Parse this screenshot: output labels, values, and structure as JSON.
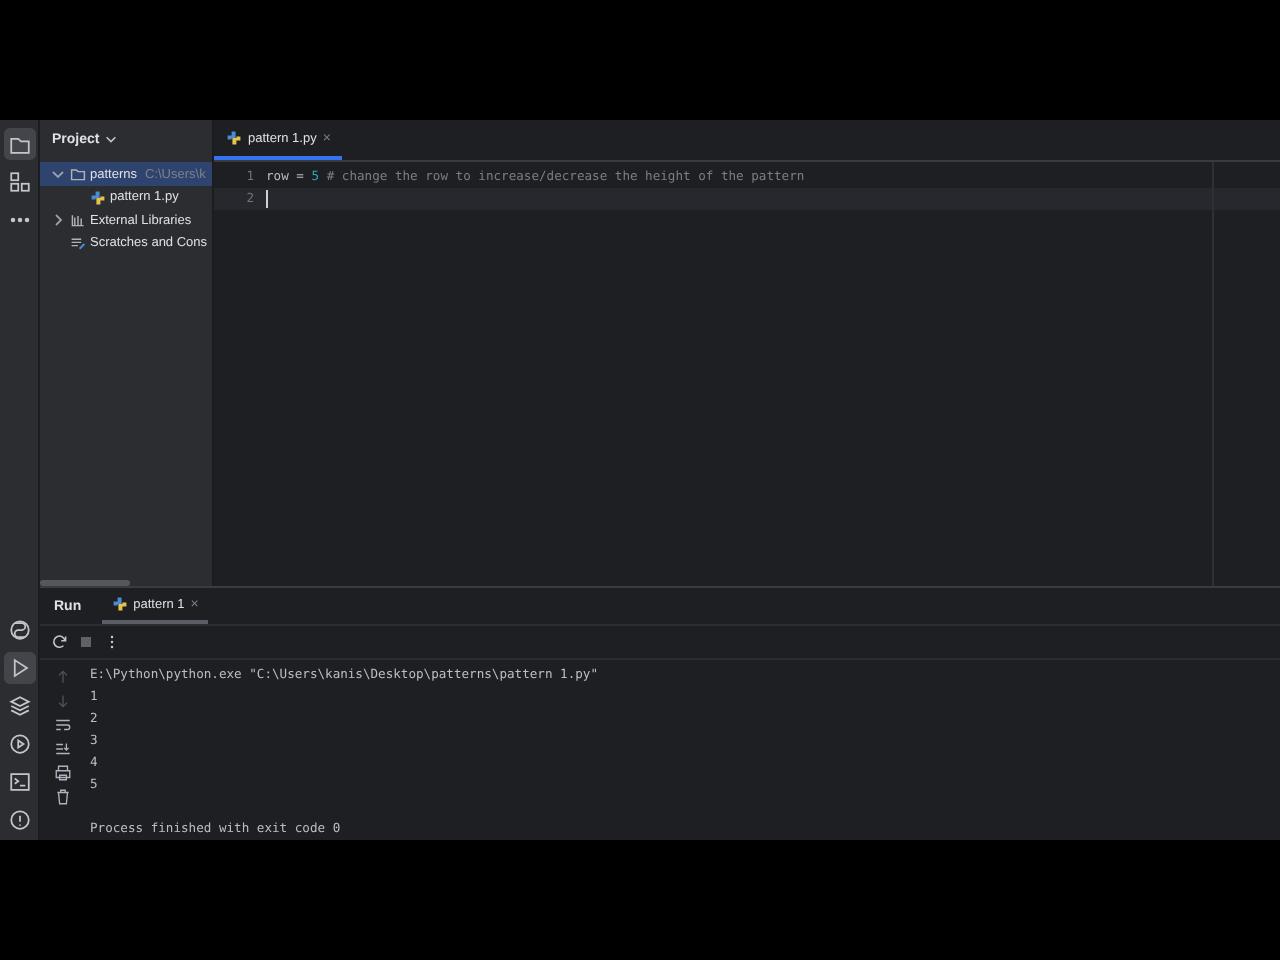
{
  "tool_strip_top": [
    {
      "kind": "folder",
      "selected": true
    },
    {
      "kind": "structure",
      "selected": false
    },
    {
      "kind": "more",
      "selected": false
    }
  ],
  "tool_strip_bottom": [
    {
      "kind": "console",
      "selected": false
    },
    {
      "kind": "run",
      "selected": true
    },
    {
      "kind": "layers",
      "selected": false
    },
    {
      "kind": "services",
      "selected": false
    },
    {
      "kind": "terminal",
      "selected": false
    },
    {
      "kind": "problems",
      "selected": false
    }
  ],
  "project": {
    "title": "Project",
    "tree": [
      {
        "kind": "folder",
        "label": "patterns",
        "path": "C:\\Users\\k",
        "expanded": true,
        "selected": true,
        "children": [
          {
            "kind": "python",
            "label": "pattern 1.py"
          }
        ]
      },
      {
        "kind": "library",
        "label": "External Libraries",
        "expanded": false,
        "selected": false
      },
      {
        "kind": "scratch",
        "label": "Scratches and Cons",
        "selected": false
      }
    ]
  },
  "editor": {
    "tabs": [
      {
        "label": "pattern 1.py",
        "close": "×",
        "selected": true
      }
    ],
    "lines": [
      {
        "number": "1",
        "current": false,
        "tokens": [
          {
            "kind": "plain",
            "text": "row = "
          },
          {
            "kind": "number",
            "text": "5"
          },
          {
            "kind": "comment",
            "text": " # change the row to increase/decrease the height of the pattern"
          }
        ]
      },
      {
        "number": "2",
        "current": true
      }
    ]
  },
  "run": {
    "title": "Run",
    "tabs": [
      {
        "label": "pattern 1",
        "close": "×",
        "selected": true
      }
    ],
    "toolbar": [
      {
        "kind": "rerun",
        "disabled": false
      },
      {
        "kind": "stop",
        "disabled": true
      },
      {
        "kind": "more",
        "disabled": false
      }
    ],
    "side_actions": [
      {
        "kind": "up",
        "disabled": true
      },
      {
        "kind": "down",
        "disabled": true
      },
      {
        "kind": "wrap",
        "disabled": false
      },
      {
        "kind": "scroll-end",
        "disabled": false
      },
      {
        "kind": "print",
        "disabled": false
      },
      {
        "kind": "trash",
        "disabled": false
      }
    ],
    "output": [
      {
        "kind": "command",
        "text": "E:\\Python\\python.exe \"C:\\Users\\kanis\\Desktop\\patterns\\pattern 1.py\""
      },
      {
        "kind": "stdout",
        "text": "1"
      },
      {
        "kind": "stdout",
        "text": "2"
      },
      {
        "kind": "stdout",
        "text": "3"
      },
      {
        "kind": "stdout",
        "text": "4"
      },
      {
        "kind": "stdout",
        "text": "5"
      },
      {
        "kind": "status",
        "text": "Process finished with exit code 0"
      }
    ]
  }
}
